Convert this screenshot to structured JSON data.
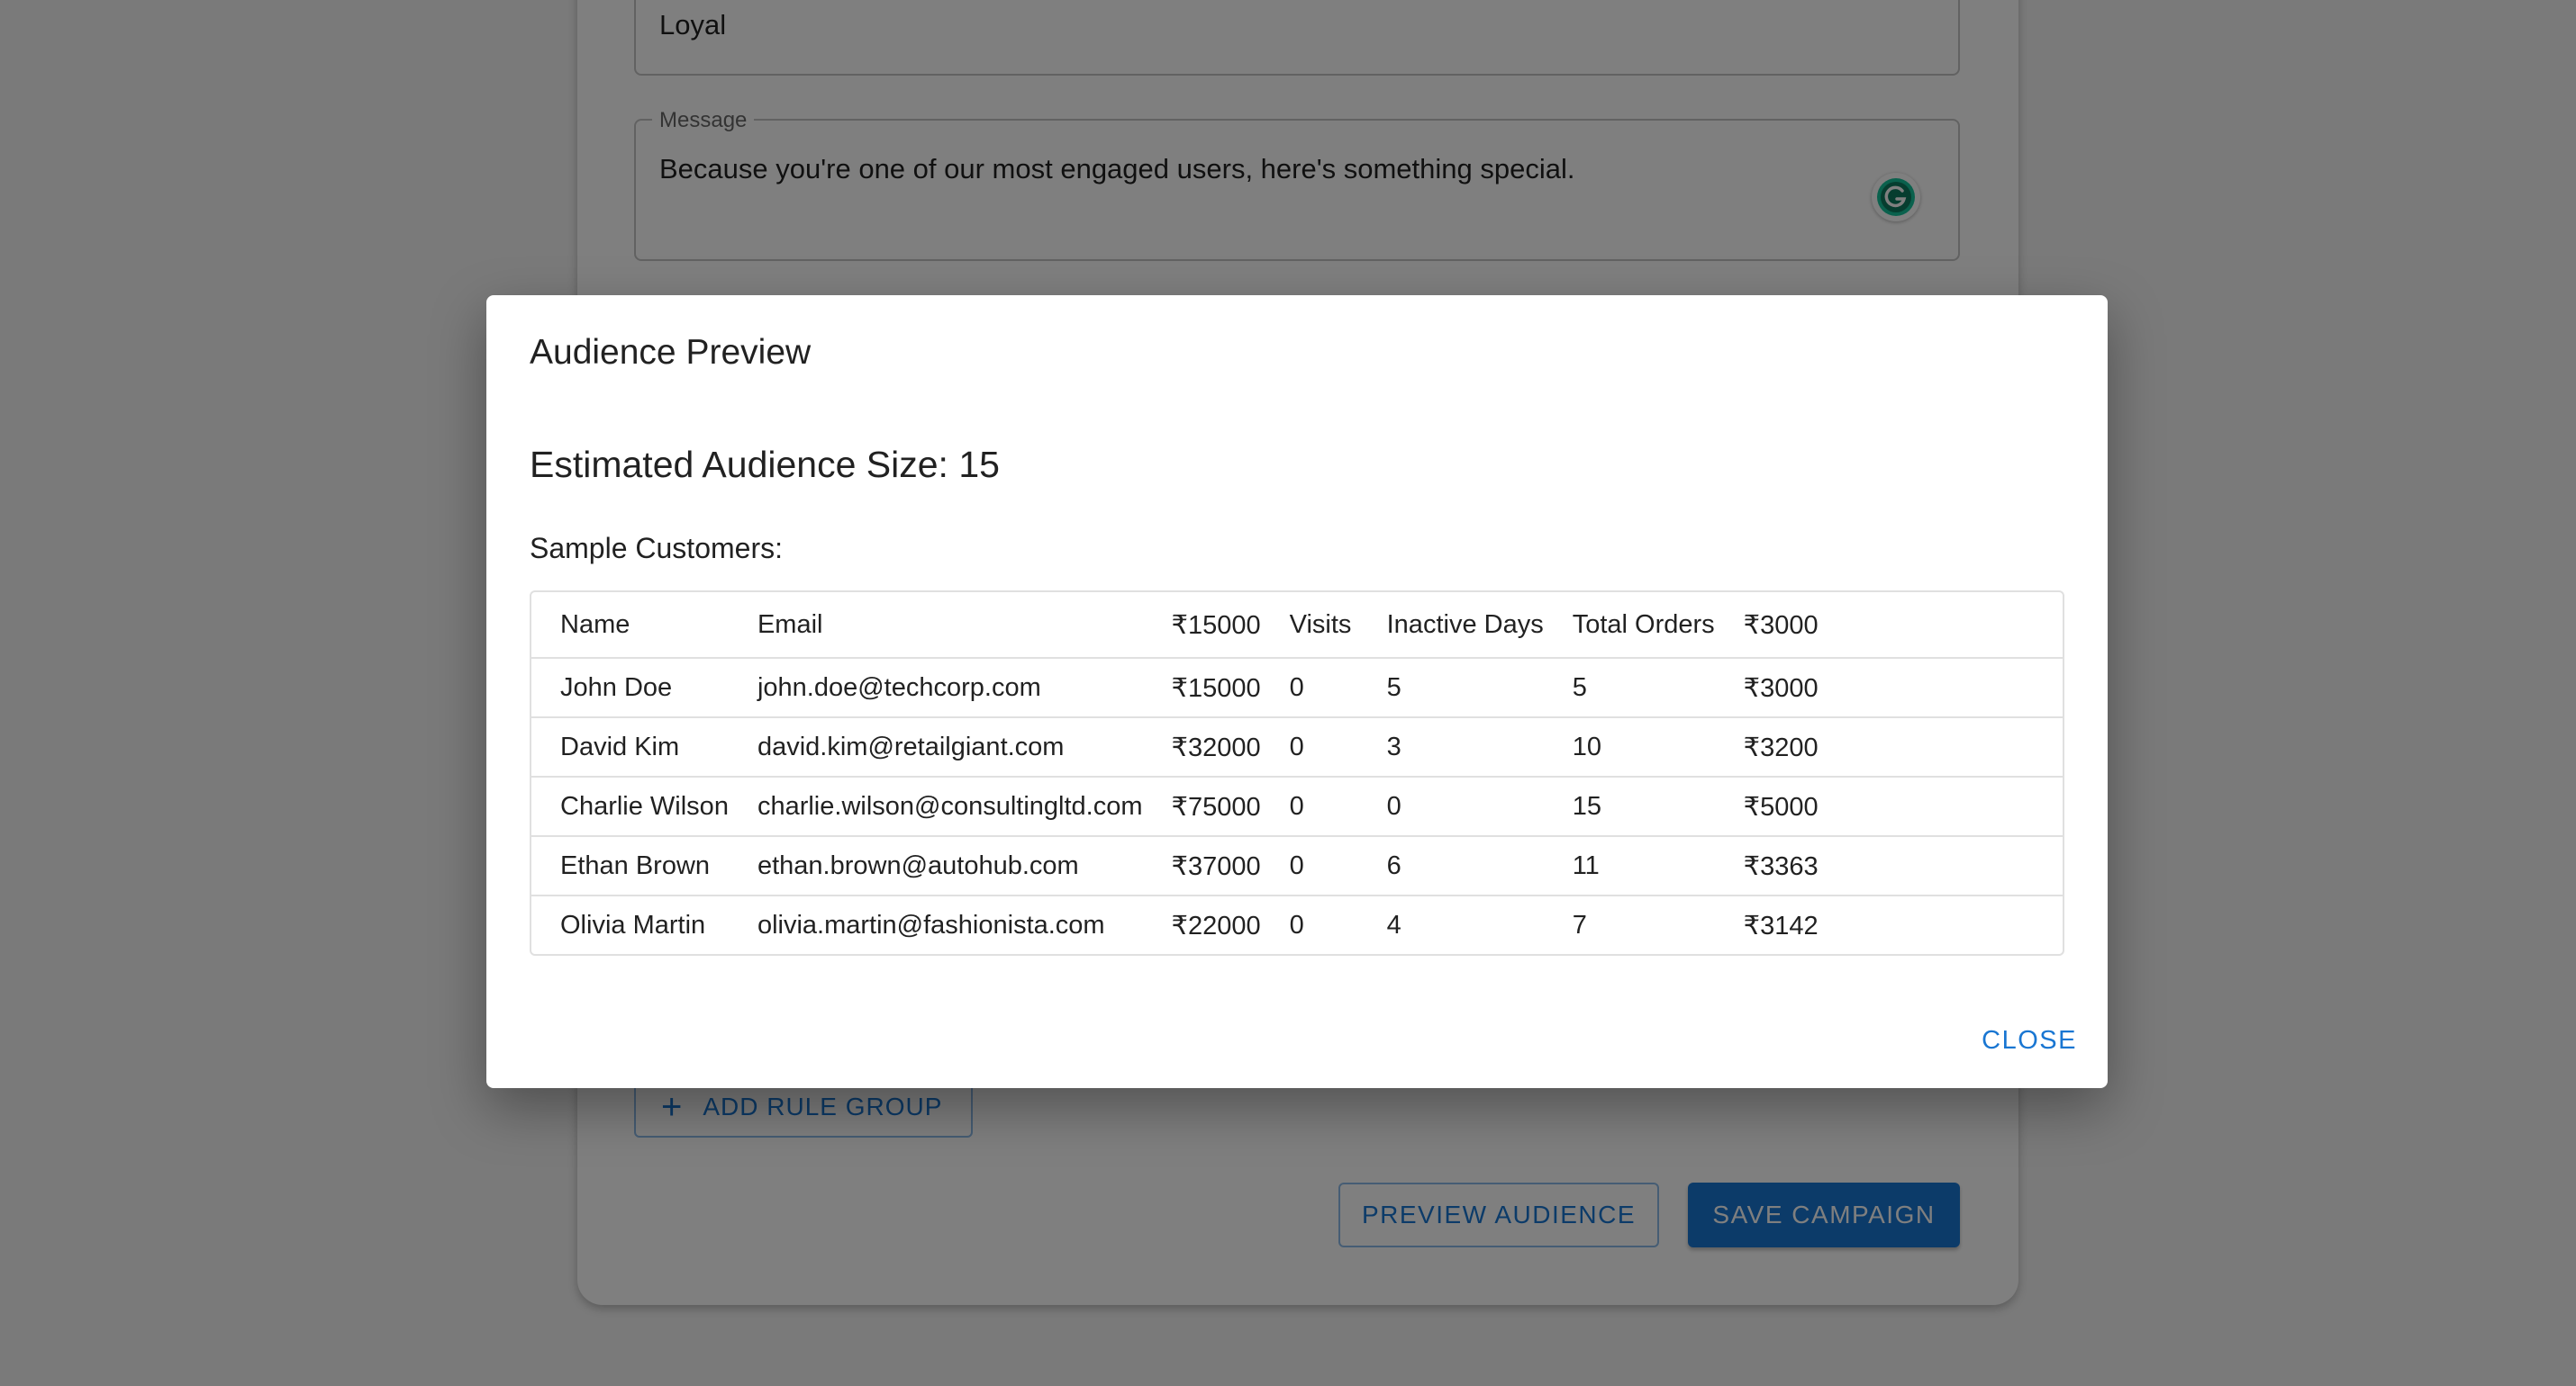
{
  "background": {
    "name_field": {
      "value": "Loyal"
    },
    "message_field": {
      "legend": "Message",
      "value": "Because you're one of our most engaged users, here's something special."
    },
    "add_rule_group_label": "ADD RULE GROUP",
    "preview_audience_label": "PREVIEW AUDIENCE",
    "save_campaign_label": "SAVE CAMPAIGN"
  },
  "dialog": {
    "title": "Audience Preview",
    "audience_size": "Estimated Audience Size: 15",
    "sample_label": "Sample Customers:",
    "table": {
      "headers": [
        "Name",
        "Email",
        "₹15000",
        "Visits",
        "Inactive Days",
        "Total Orders",
        "₹3000"
      ],
      "rows": [
        [
          "John Doe",
          "john.doe@techcorp.com",
          "₹15000",
          "0",
          "5",
          "5",
          "₹3000"
        ],
        [
          "David Kim",
          "david.kim@retailgiant.com",
          "₹32000",
          "0",
          "3",
          "10",
          "₹3200"
        ],
        [
          "Charlie Wilson",
          "charlie.wilson@consultingltd.com",
          "₹75000",
          "0",
          "0",
          "15",
          "₹5000"
        ],
        [
          "Ethan Brown",
          "ethan.brown@autohub.com",
          "₹37000",
          "0",
          "6",
          "11",
          "₹3363"
        ],
        [
          "Olivia Martin",
          "olivia.martin@fashionista.com",
          "₹22000",
          "0",
          "4",
          "7",
          "₹3142"
        ]
      ]
    },
    "close_label": "CLOSE"
  },
  "colors": {
    "primary": "#1976d2",
    "backdrop": "rgba(0,0,0,0.5)",
    "grammarly": "#15c39a"
  },
  "icons": {
    "grammarly": "grammarly-icon",
    "add": "plus-icon"
  }
}
